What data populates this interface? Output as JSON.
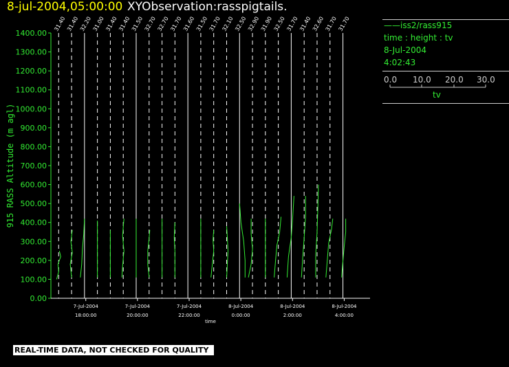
{
  "header": {
    "date_time": "8-jul-2004,05:00:00",
    "title": "XYObservation:rasspigtails."
  },
  "legend": {
    "series_line": "——iss2/rass915",
    "line2": "time : height : tv",
    "line3": "8-Jul-2004",
    "line4": "4:02:43",
    "scale_ticks": [
      "0.0",
      "10.0",
      "20.0",
      "30.0"
    ],
    "scale_label": "tv"
  },
  "footer": {
    "notice": "REAL-TIME DATA, NOT CHECKED FOR QUALITY"
  },
  "colors": {
    "axis": "#33ee33",
    "data": "#33ee33",
    "reference": "#ffffff",
    "title_date": "#ffff00",
    "background": "#000000"
  },
  "chart_data": {
    "type": "line",
    "title": "XYObservation:rasspigtails.",
    "xlabel": "time",
    "ylabel": "915 RASS Altitude (m agl)",
    "ylim": [
      0,
      1400
    ],
    "yticks": [
      "0.00",
      "100.00",
      "200.00",
      "300.00",
      "400.00",
      "500.00",
      "600.00",
      "700.00",
      "800.00",
      "900.00",
      "1000.00",
      "1100.00",
      "1200.00",
      "1300.00",
      "1400.00"
    ],
    "xlim_hours": [
      16.65,
      5.0
    ],
    "xticks": [
      {
        "hour": 18,
        "line1": "7-Jul-2004",
        "line2": "18:00:00"
      },
      {
        "hour": 20,
        "line1": "7-Jul-2004",
        "line2": "20:00:00"
      },
      {
        "hour": 22,
        "line1": "7-Jul-2004",
        "line2": "22:00:00"
      },
      {
        "hour": 24,
        "line1": "8-Jul-2004",
        "line2": "0:00:00"
      },
      {
        "hour": 26,
        "line1": "8-Jul-2004",
        "line2": "2:00:00"
      },
      {
        "hour": 28,
        "line1": "8-Jul-2004",
        "line2": "4:00:00"
      }
    ],
    "profiles": [
      {
        "hour": 16.95,
        "ref": "31.40",
        "solid": false,
        "pts": [
          [
            -1.5,
            100
          ],
          [
            0,
            140
          ],
          [
            -0.5,
            180
          ],
          [
            1.5,
            220
          ],
          [
            0.5,
            250
          ]
        ]
      },
      {
        "hour": 17.45,
        "ref": "31.40",
        "solid": false,
        "pts": [
          [
            0,
            110
          ],
          [
            -1,
            180
          ],
          [
            0.5,
            240
          ],
          [
            -0.5,
            300
          ],
          [
            0.5,
            360
          ]
        ]
      },
      {
        "hour": 17.95,
        "ref": "32.20",
        "solid": true,
        "pts": [
          [
            -3,
            110
          ],
          [
            -2,
            180
          ],
          [
            -1.5,
            260
          ],
          [
            -0.5,
            340
          ],
          [
            0,
            420
          ]
        ]
      },
      {
        "hour": 18.45,
        "ref": "31.00",
        "solid": false,
        "pts": [
          [
            0,
            110
          ],
          [
            0,
            180
          ],
          [
            0,
            250
          ],
          [
            0,
            310
          ],
          [
            0,
            410
          ]
        ]
      },
      {
        "hour": 18.95,
        "ref": "31.40",
        "solid": false,
        "pts": [
          [
            0,
            110
          ],
          [
            0,
            180
          ],
          [
            0,
            250
          ],
          [
            0,
            300
          ],
          [
            0,
            360
          ]
        ]
      },
      {
        "hour": 19.45,
        "ref": "31.40",
        "solid": false,
        "pts": [
          [
            -1,
            110
          ],
          [
            -0.5,
            170
          ],
          [
            0.5,
            250
          ],
          [
            -0.5,
            330
          ],
          [
            0.5,
            420
          ]
        ]
      },
      {
        "hour": 19.95,
        "ref": "31.50",
        "solid": true,
        "pts": [
          [
            0,
            110
          ],
          [
            0,
            180
          ],
          [
            0,
            260
          ],
          [
            0,
            330
          ],
          [
            0,
            420
          ]
        ]
      },
      {
        "hour": 20.45,
        "ref": "32.70",
        "solid": false,
        "pts": [
          [
            0,
            110
          ],
          [
            -1,
            180
          ],
          [
            -1,
            250
          ],
          [
            0,
            320
          ],
          [
            0.5,
            360
          ]
        ]
      },
      {
        "hour": 20.95,
        "ref": "32.70",
        "solid": false,
        "pts": [
          [
            0,
            110
          ],
          [
            0,
            180
          ],
          [
            0,
            250
          ],
          [
            0,
            330
          ],
          [
            0,
            420
          ]
        ]
      },
      {
        "hour": 21.45,
        "ref": "31.70",
        "solid": false,
        "pts": [
          [
            0,
            110
          ],
          [
            0,
            180
          ],
          [
            0,
            250
          ],
          [
            -0.5,
            320
          ],
          [
            0,
            400
          ]
        ]
      },
      {
        "hour": 21.95,
        "ref": "31.60",
        "solid": true,
        "pts": []
      },
      {
        "hour": 22.45,
        "ref": "31.50",
        "solid": false,
        "pts": [
          [
            0,
            110
          ],
          [
            0,
            180
          ],
          [
            0,
            250
          ],
          [
            0,
            330
          ],
          [
            0,
            420
          ]
        ]
      },
      {
        "hour": 22.95,
        "ref": "31.70",
        "solid": false,
        "pts": [
          [
            -2,
            110
          ],
          [
            -1,
            180
          ],
          [
            0,
            250
          ],
          [
            -0.5,
            310
          ],
          [
            0,
            360
          ]
        ]
      },
      {
        "hour": 23.45,
        "ref": "32.10",
        "solid": false,
        "pts": [
          [
            0,
            110
          ],
          [
            0.5,
            180
          ],
          [
            1,
            250
          ],
          [
            0.5,
            320
          ],
          [
            0,
            380
          ]
        ]
      },
      {
        "hour": 23.95,
        "ref": "32.50",
        "solid": true,
        "pts": [
          [
            4,
            110
          ],
          [
            4,
            200
          ],
          [
            3,
            300
          ],
          [
            1,
            400
          ],
          [
            0,
            500
          ]
        ]
      },
      {
        "hour": 24.45,
        "ref": "32.90",
        "solid": false,
        "pts": [
          [
            -3,
            110
          ],
          [
            -1,
            180
          ],
          [
            0,
            260
          ],
          [
            -1,
            340
          ],
          [
            -1,
            420
          ]
        ]
      },
      {
        "hour": 24.95,
        "ref": "31.90",
        "solid": false,
        "pts": [
          [
            0,
            110
          ],
          [
            0,
            180
          ],
          [
            0,
            250
          ],
          [
            0,
            330
          ],
          [
            0,
            420
          ]
        ]
      },
      {
        "hour": 25.45,
        "ref": "32.50",
        "solid": false,
        "pts": [
          [
            -3,
            110
          ],
          [
            -2,
            200
          ],
          [
            -1,
            280
          ],
          [
            1,
            350
          ],
          [
            2,
            430
          ]
        ]
      },
      {
        "hour": 25.95,
        "ref": "31.70",
        "solid": true,
        "pts": [
          [
            -3,
            110
          ],
          [
            -2,
            220
          ],
          [
            0,
            320
          ],
          [
            1,
            420
          ],
          [
            2,
            540
          ]
        ]
      },
      {
        "hour": 26.45,
        "ref": "31.40",
        "solid": false,
        "pts": [
          [
            -2,
            110
          ],
          [
            -1,
            220
          ],
          [
            0,
            320
          ],
          [
            1,
            430
          ],
          [
            1,
            540
          ]
        ]
      },
      {
        "hour": 26.95,
        "ref": "32.60",
        "solid": false,
        "pts": [
          [
            -1,
            110
          ],
          [
            -1,
            230
          ],
          [
            0,
            350
          ],
          [
            0.5,
            470
          ],
          [
            1,
            600
          ]
        ]
      },
      {
        "hour": 27.45,
        "ref": "31.70",
        "solid": false,
        "pts": [
          [
            -3,
            110
          ],
          [
            -2,
            200
          ],
          [
            -1,
            290
          ],
          [
            1,
            360
          ],
          [
            2,
            420
          ]
        ]
      },
      {
        "hour": 27.95,
        "ref": "31.70",
        "solid": true,
        "pts": [
          [
            -1,
            110
          ],
          [
            0,
            200
          ],
          [
            1,
            280
          ],
          [
            2,
            350
          ],
          [
            2,
            420
          ]
        ]
      }
    ]
  }
}
